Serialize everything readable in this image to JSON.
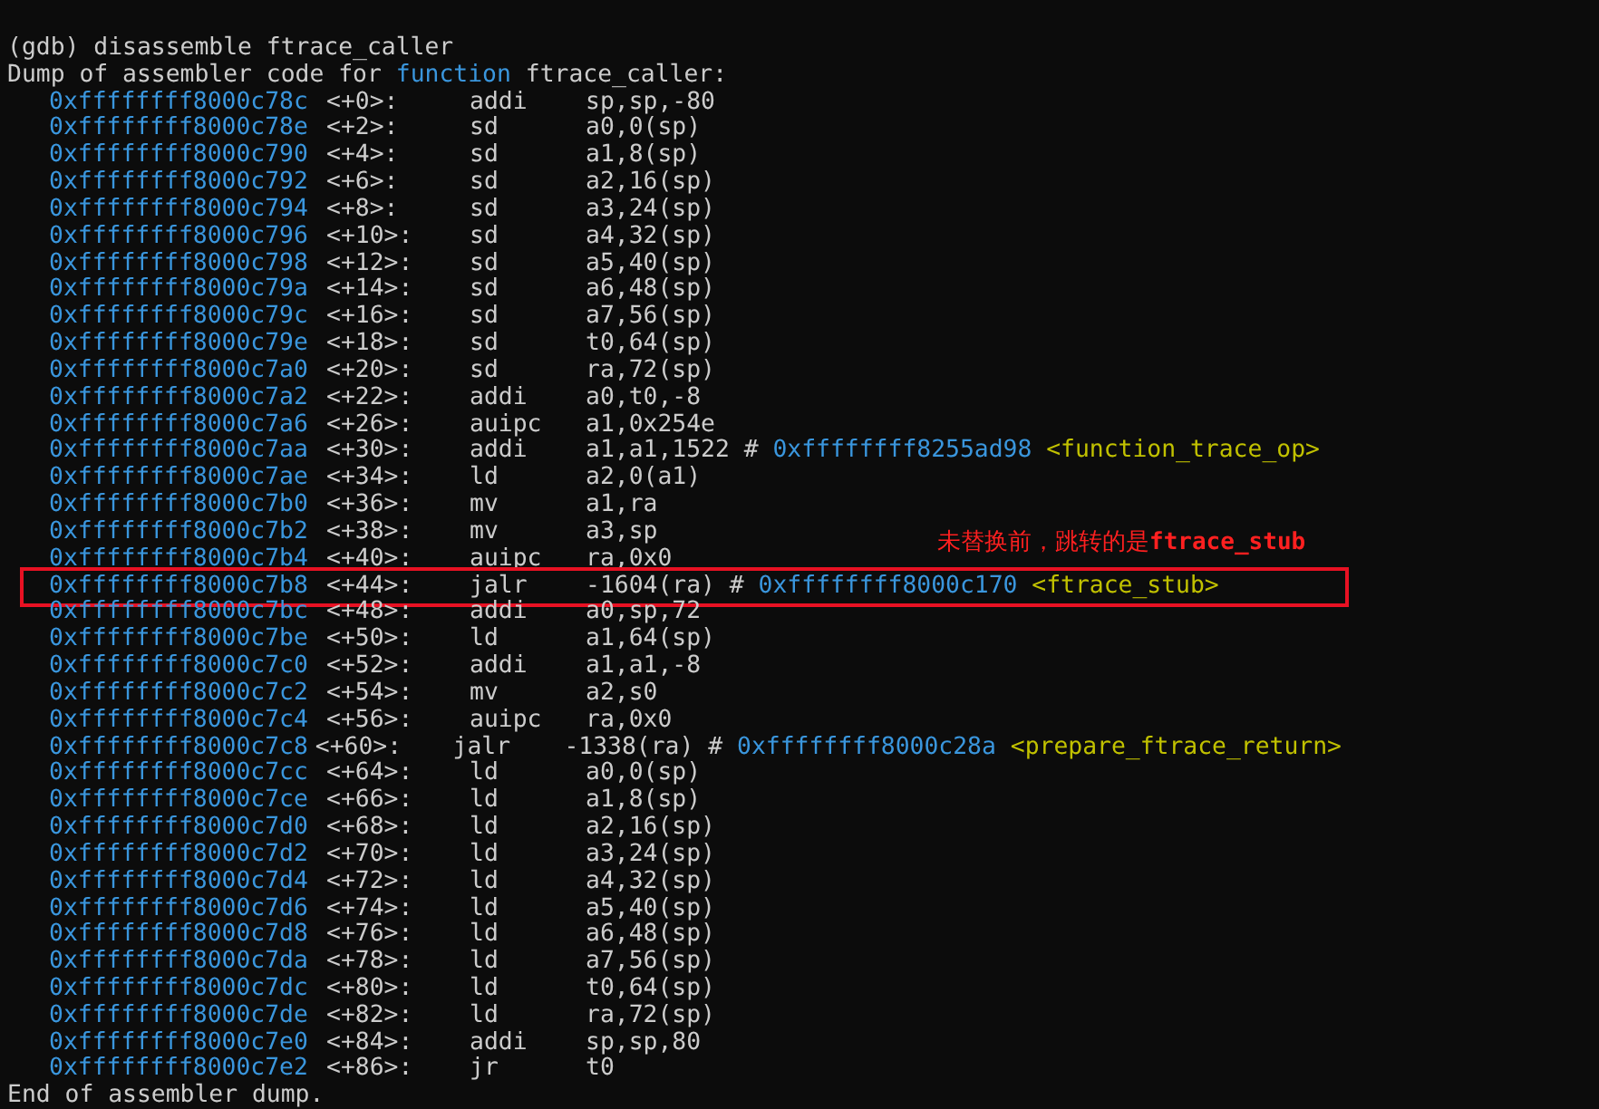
{
  "command": "(gdb) disassemble ftrace_caller",
  "header": {
    "before": "Dump of assembler code for",
    "keyword": "function",
    "after": "ftrace_caller:"
  },
  "rows": [
    {
      "address": "0xffffffff8000c78c",
      "offset": "<+0>:",
      "mnemonic": "addi",
      "operands": "sp,sp,-80",
      "highlighted": false
    },
    {
      "address": "0xffffffff8000c78e",
      "offset": "<+2>:",
      "mnemonic": "sd",
      "operands": "a0,0(sp)",
      "highlighted": false
    },
    {
      "address": "0xffffffff8000c790",
      "offset": "<+4>:",
      "mnemonic": "sd",
      "operands": "a1,8(sp)",
      "highlighted": false
    },
    {
      "address": "0xffffffff8000c792",
      "offset": "<+6>:",
      "mnemonic": "sd",
      "operands": "a2,16(sp)",
      "highlighted": false
    },
    {
      "address": "0xffffffff8000c794",
      "offset": "<+8>:",
      "mnemonic": "sd",
      "operands": "a3,24(sp)",
      "highlighted": false
    },
    {
      "address": "0xffffffff8000c796",
      "offset": "<+10>:",
      "mnemonic": "sd",
      "operands": "a4,32(sp)",
      "highlighted": false
    },
    {
      "address": "0xffffffff8000c798",
      "offset": "<+12>:",
      "mnemonic": "sd",
      "operands": "a5,40(sp)",
      "highlighted": false
    },
    {
      "address": "0xffffffff8000c79a",
      "offset": "<+14>:",
      "mnemonic": "sd",
      "operands": "a6,48(sp)",
      "highlighted": false
    },
    {
      "address": "0xffffffff8000c79c",
      "offset": "<+16>:",
      "mnemonic": "sd",
      "operands": "a7,56(sp)",
      "highlighted": false
    },
    {
      "address": "0xffffffff8000c79e",
      "offset": "<+18>:",
      "mnemonic": "sd",
      "operands": "t0,64(sp)",
      "highlighted": false
    },
    {
      "address": "0xffffffff8000c7a0",
      "offset": "<+20>:",
      "mnemonic": "sd",
      "operands": "ra,72(sp)",
      "highlighted": false
    },
    {
      "address": "0xffffffff8000c7a2",
      "offset": "<+22>:",
      "mnemonic": "addi",
      "operands": "a0,t0,-8",
      "highlighted": false
    },
    {
      "address": "0xffffffff8000c7a6",
      "offset": "<+26>:",
      "mnemonic": "auipc",
      "operands": "a1,0x254e",
      "highlighted": false
    },
    {
      "address": "0xffffffff8000c7aa",
      "offset": "<+30>:",
      "mnemonic": "addi",
      "operands": "a1,a1,1522",
      "comment_mark": "#",
      "target": "0xffffffff8255ad98",
      "symbol": "<function_trace_op>",
      "highlighted": false
    },
    {
      "address": "0xffffffff8000c7ae",
      "offset": "<+34>:",
      "mnemonic": "ld",
      "operands": "a2,0(a1)",
      "highlighted": false
    },
    {
      "address": "0xffffffff8000c7b0",
      "offset": "<+36>:",
      "mnemonic": "mv",
      "operands": "a1,ra",
      "highlighted": false
    },
    {
      "address": "0xffffffff8000c7b2",
      "offset": "<+38>:",
      "mnemonic": "mv",
      "operands": "a3,sp",
      "highlighted": false
    },
    {
      "address": "0xffffffff8000c7b4",
      "offset": "<+40>:",
      "mnemonic": "auipc",
      "operands": "ra,0x0",
      "highlighted": false
    },
    {
      "address": "0xffffffff8000c7b8",
      "offset": "<+44>:",
      "mnemonic": "jalr",
      "operands": "-1604(ra)",
      "comment_mark": "#",
      "target": "0xffffffff8000c170",
      "symbol": "<ftrace_stub>",
      "highlighted": true,
      "annotation": "未替换前，跳转的是**ftrace_stub**"
    },
    {
      "address": "0xffffffff8000c7bc",
      "offset": "<+48>:",
      "mnemonic": "addi",
      "operands": "a0,sp,72",
      "highlighted": false
    },
    {
      "address": "0xffffffff8000c7be",
      "offset": "<+50>:",
      "mnemonic": "ld",
      "operands": "a1,64(sp)",
      "highlighted": false
    },
    {
      "address": "0xffffffff8000c7c0",
      "offset": "<+52>:",
      "mnemonic": "addi",
      "operands": "a1,a1,-8",
      "highlighted": false
    },
    {
      "address": "0xffffffff8000c7c2",
      "offset": "<+54>:",
      "mnemonic": "mv",
      "operands": "a2,s0",
      "highlighted": false
    },
    {
      "address": "0xffffffff8000c7c4",
      "offset": "<+56>:",
      "mnemonic": "auipc",
      "operands": "ra,0x0",
      "highlighted": false
    },
    {
      "address": "0xffffffff8000c7c8",
      "offset": "<+60>:",
      "mnemonic": "jalr",
      "operands": "-1338(ra)",
      "comment_mark": "#",
      "target": "0xffffffff8000c28a",
      "symbol": "<prepare_ftrace_return>",
      "highlighted": false
    },
    {
      "address": "0xffffffff8000c7cc",
      "offset": "<+64>:",
      "mnemonic": "ld",
      "operands": "a0,0(sp)",
      "highlighted": false
    },
    {
      "address": "0xffffffff8000c7ce",
      "offset": "<+66>:",
      "mnemonic": "ld",
      "operands": "a1,8(sp)",
      "highlighted": false
    },
    {
      "address": "0xffffffff8000c7d0",
      "offset": "<+68>:",
      "mnemonic": "ld",
      "operands": "a2,16(sp)",
      "highlighted": false
    },
    {
      "address": "0xffffffff8000c7d2",
      "offset": "<+70>:",
      "mnemonic": "ld",
      "operands": "a3,24(sp)",
      "highlighted": false
    },
    {
      "address": "0xffffffff8000c7d4",
      "offset": "<+72>:",
      "mnemonic": "ld",
      "operands": "a4,32(sp)",
      "highlighted": false
    },
    {
      "address": "0xffffffff8000c7d6",
      "offset": "<+74>:",
      "mnemonic": "ld",
      "operands": "a5,40(sp)",
      "highlighted": false
    },
    {
      "address": "0xffffffff8000c7d8",
      "offset": "<+76>:",
      "mnemonic": "ld",
      "operands": "a6,48(sp)",
      "highlighted": false
    },
    {
      "address": "0xffffffff8000c7da",
      "offset": "<+78>:",
      "mnemonic": "ld",
      "operands": "a7,56(sp)",
      "highlighted": false
    },
    {
      "address": "0xffffffff8000c7dc",
      "offset": "<+80>:",
      "mnemonic": "ld",
      "operands": "t0,64(sp)",
      "highlighted": false
    },
    {
      "address": "0xffffffff8000c7de",
      "offset": "<+82>:",
      "mnemonic": "ld",
      "operands": "ra,72(sp)",
      "highlighted": false
    },
    {
      "address": "0xffffffff8000c7e0",
      "offset": "<+84>:",
      "mnemonic": "addi",
      "operands": "sp,sp,80",
      "highlighted": false
    },
    {
      "address": "0xffffffff8000c7e2",
      "offset": "<+86>:",
      "mnemonic": "jr",
      "operands": "t0",
      "highlighted": false
    }
  ],
  "footer": "End of assembler dump."
}
